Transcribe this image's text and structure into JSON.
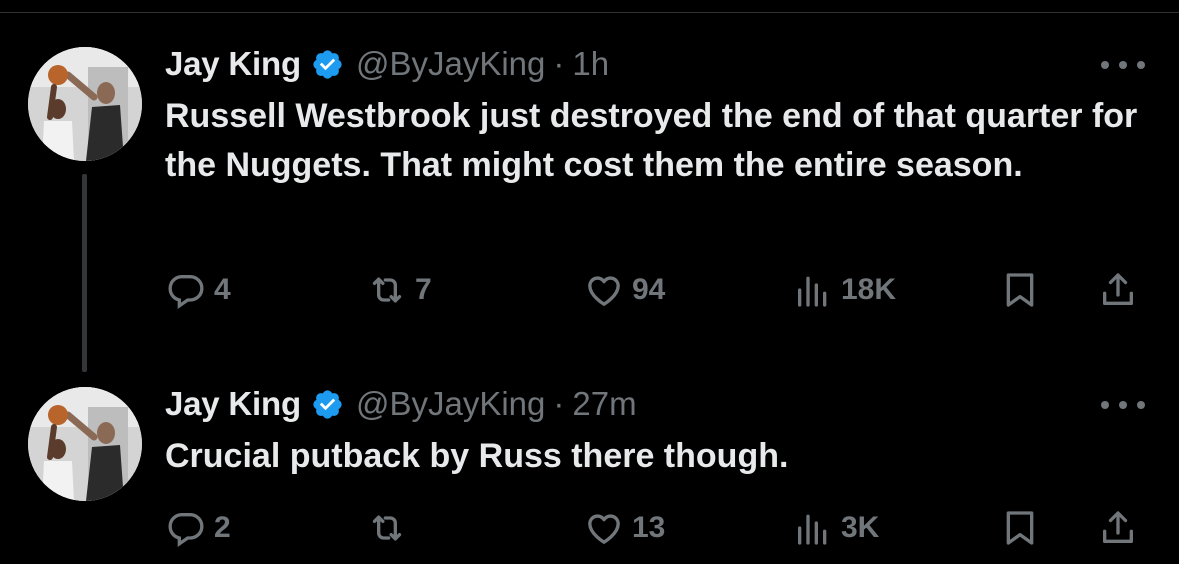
{
  "tweets": [
    {
      "name": "Jay King",
      "handle": "@ByJayKing",
      "separator": "·",
      "time": "1h",
      "text": "Russell Westbrook just destroyed the end of that quarter for the Nuggets. That might cost them the entire season.",
      "replies": "4",
      "retweets": "7",
      "likes": "94",
      "views": "18K"
    },
    {
      "name": "Jay King",
      "handle": "@ByJayKing",
      "separator": "·",
      "time": "27m",
      "text": "Crucial putback by Russ there though.",
      "replies": "2",
      "retweets": "",
      "likes": "13",
      "views": "3K"
    }
  ],
  "colors": {
    "background": "#000000",
    "text": "#e7e9ea",
    "muted": "#71767b",
    "verified": "#1d9bf0",
    "divider": "#2f3336"
  },
  "icons": [
    "verified-badge-icon",
    "more-icon",
    "reply-icon",
    "retweet-icon",
    "like-icon",
    "views-icon",
    "bookmark-icon",
    "share-icon"
  ]
}
